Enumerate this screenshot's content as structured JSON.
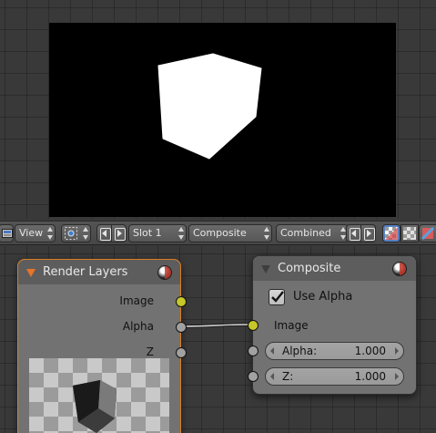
{
  "header": {
    "view_menu": "View",
    "slot_select": "Slot 1",
    "composite_select": "Composite",
    "pass_select": "Combined"
  },
  "viewer": {
    "backdrop_color": "#000000",
    "cube_color": "#ffffff"
  },
  "nodes": {
    "render_layers": {
      "title": "Render Layers",
      "accent_color": "#e9742a",
      "outputs": [
        {
          "label": "Image",
          "socket_color": "#c7c729"
        },
        {
          "label": "Alpha",
          "socket_color": "#a1a1a1"
        },
        {
          "label": "Z",
          "socket_color": "#a1a1a1"
        }
      ]
    },
    "composite": {
      "title": "Composite",
      "use_alpha_label": "Use Alpha",
      "use_alpha_checked": true,
      "image_input_label": "Image",
      "alpha_field": {
        "label": "Alpha:",
        "value": "1.000"
      },
      "z_field": {
        "label": "Z:",
        "value": "1.000"
      }
    }
  },
  "link": {
    "from": "Alpha",
    "to": "Image"
  }
}
